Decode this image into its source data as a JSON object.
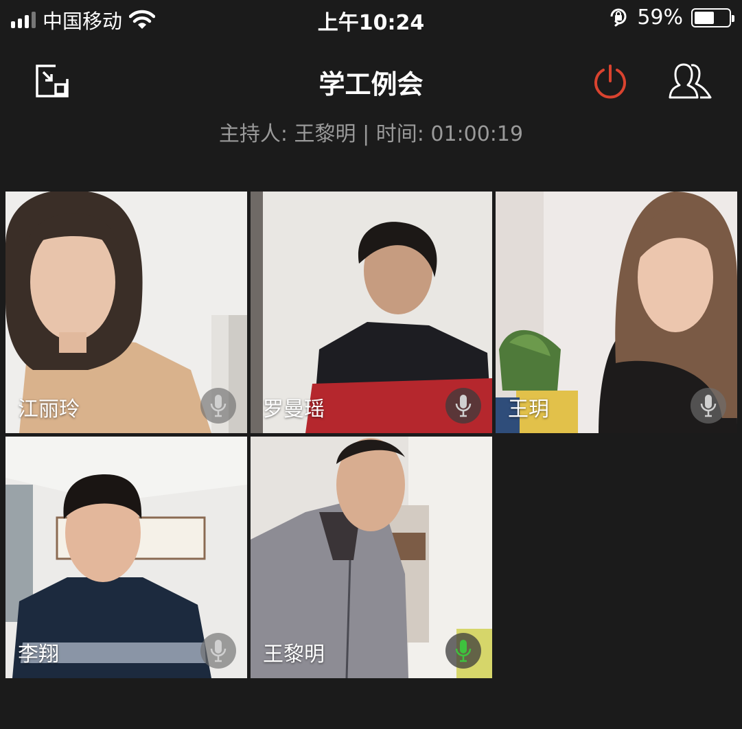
{
  "status_bar": {
    "carrier": "中国移动",
    "time": "上午10:24",
    "battery_percent": "59%",
    "battery_level": 0.59,
    "signal_bars_active": 3,
    "icons": [
      "signal-icon",
      "wifi-icon",
      "orientation-lock-icon",
      "battery-icon"
    ]
  },
  "header": {
    "title": "学工例会",
    "subtitle": "主持人: 王黎明 | 时间: 01:00:19",
    "power_color": "#d9432f",
    "icons": [
      "minimize-window-icon",
      "power-icon",
      "participants-icon"
    ]
  },
  "participants": [
    {
      "name": "江丽玲",
      "mic": "muted"
    },
    {
      "name": "罗曼瑶",
      "mic": "muted"
    },
    {
      "name": "王玥",
      "mic": "muted"
    },
    {
      "name": "李翔",
      "mic": "muted"
    },
    {
      "name": "王黎明",
      "mic": "speaking"
    }
  ],
  "colors": {
    "background": "#1b1b1b",
    "mic_active": "#3ec23e",
    "mic_muted": "#d0d0d0"
  }
}
